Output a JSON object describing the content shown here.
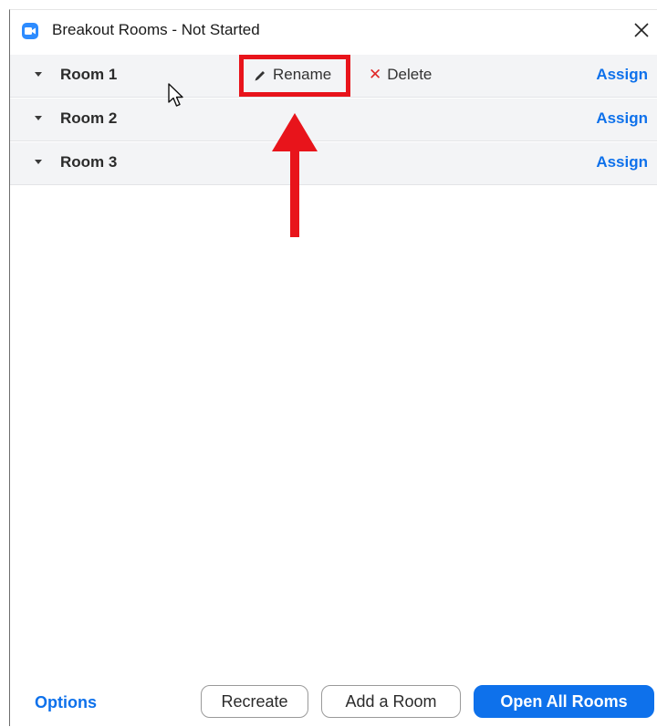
{
  "window": {
    "title": "Breakout Rooms - Not Started"
  },
  "rooms": [
    {
      "name": "Room 1",
      "assign_label": "Assign"
    },
    {
      "name": "Room 2",
      "assign_label": "Assign"
    },
    {
      "name": "Room 3",
      "assign_label": "Assign"
    }
  ],
  "room_actions": {
    "rename_label": "Rename",
    "delete_label": "Delete"
  },
  "footer": {
    "options_label": "Options",
    "recreate_label": "Recreate",
    "add_room_label": "Add a Room",
    "open_all_label": "Open All Rooms"
  },
  "colors": {
    "accent": "#0e71eb",
    "annotation": "#e8141b",
    "row_background": "#f3f4f6"
  },
  "icons": {
    "app": "zoom-video-icon",
    "close": "close-icon",
    "caret": "caret-down-icon",
    "rename": "pencil-icon",
    "delete": "x-icon"
  }
}
